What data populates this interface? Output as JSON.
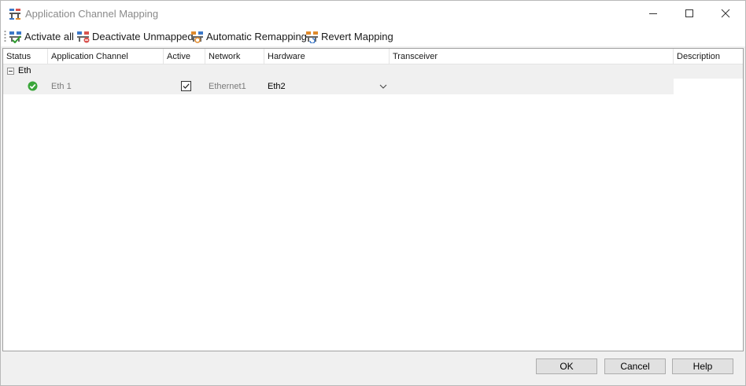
{
  "window": {
    "title": "Application Channel Mapping"
  },
  "toolbar": {
    "activate_all": "Activate all",
    "deactivate_unmapped": "Deactivate Unmapped",
    "automatic_remapping": "Automatic Remapping",
    "revert_mapping": "Revert Mapping"
  },
  "grid": {
    "columns": [
      "Status",
      "Application Channel",
      "Active",
      "Network",
      "Hardware",
      "Transceiver",
      "Description"
    ],
    "groups": [
      {
        "label": "Eth",
        "rows": [
          {
            "status": "ok",
            "application_channel": "Eth 1",
            "active": true,
            "network": "Ethernet1",
            "hardware": "Eth2",
            "transceiver": "",
            "description": ""
          }
        ]
      }
    ]
  },
  "footer": {
    "ok": "OK",
    "cancel": "Cancel",
    "help": "Help"
  },
  "icons": {
    "status_ok": "check-circle-icon",
    "status_ok_color": "#3aa63a"
  }
}
